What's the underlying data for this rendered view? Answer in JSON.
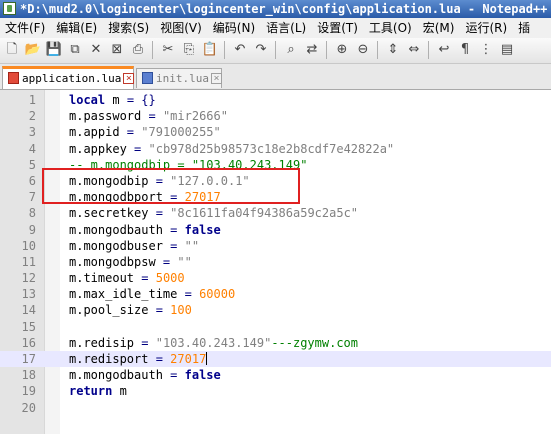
{
  "window": {
    "title": "*D:\\mud2.0\\logincenter\\logincenter_win\\config\\application.lua - Notepad++ [A"
  },
  "menu": [
    "文件(F)",
    "编辑(E)",
    "搜索(S)",
    "视图(V)",
    "编码(N)",
    "语言(L)",
    "设置(T)",
    "工具(O)",
    "宏(M)",
    "运行(R)",
    "插"
  ],
  "toolbar_icons": [
    "new-file-icon",
    "open-file-icon",
    "save-icon",
    "save-all-icon",
    "close-icon",
    "close-all-icon",
    "print-icon",
    "cut-icon",
    "copy-icon",
    "paste-icon",
    "undo-icon",
    "redo-icon",
    "find-icon",
    "replace-icon",
    "zoom-in-icon",
    "zoom-out-icon",
    "sync-vertical-icon",
    "sync-horizontal-icon",
    "word-wrap-icon",
    "show-all-chars-icon",
    "indent-guide-icon",
    "document-map-icon"
  ],
  "tabs": [
    {
      "label": "application.lua",
      "active": true,
      "modified": true
    },
    {
      "label": "init.lua",
      "active": false,
      "modified": false
    }
  ],
  "editor": {
    "current_line": 17,
    "highlighted_lines": [
      6,
      7
    ],
    "lines": [
      {
        "n": "1",
        "tokens": [
          [
            "kw",
            "local"
          ],
          [
            "t",
            " m "
          ],
          [
            "op",
            "="
          ],
          [
            "t",
            " "
          ],
          [
            "op",
            "{}"
          ]
        ]
      },
      {
        "n": "2",
        "tokens": [
          [
            "t",
            "m.password "
          ],
          [
            "op",
            "="
          ],
          [
            "t",
            " "
          ],
          [
            "str",
            "\"mir2666\""
          ]
        ]
      },
      {
        "n": "3",
        "tokens": [
          [
            "t",
            "m.appid "
          ],
          [
            "op",
            "="
          ],
          [
            "t",
            " "
          ],
          [
            "str",
            "\"791000255\""
          ]
        ]
      },
      {
        "n": "4",
        "tokens": [
          [
            "t",
            "m.appkey "
          ],
          [
            "op",
            "="
          ],
          [
            "t",
            " "
          ],
          [
            "str",
            "\"cb978d25b98573c18e2b8cdf7e42822a\""
          ]
        ]
      },
      {
        "n": "5",
        "tokens": [
          [
            "cmt",
            "-- m.mongodbip = \"103.40.243.149\""
          ]
        ]
      },
      {
        "n": "6",
        "tokens": [
          [
            "t",
            "m.mongodbip "
          ],
          [
            "op",
            "="
          ],
          [
            "t",
            " "
          ],
          [
            "str",
            "\"127.0.0.1\""
          ]
        ]
      },
      {
        "n": "7",
        "tokens": [
          [
            "t",
            "m.mongodbport "
          ],
          [
            "op",
            "="
          ],
          [
            "t",
            " "
          ],
          [
            "num",
            "27017"
          ]
        ]
      },
      {
        "n": "8",
        "tokens": [
          [
            "t",
            "m.secretkey "
          ],
          [
            "op",
            "="
          ],
          [
            "t",
            " "
          ],
          [
            "str",
            "\"8c1611fa04f94386a59c2a5c\""
          ]
        ]
      },
      {
        "n": "9",
        "tokens": [
          [
            "t",
            "m.mongodbauth "
          ],
          [
            "op",
            "="
          ],
          [
            "t",
            " "
          ],
          [
            "kw",
            "false"
          ]
        ]
      },
      {
        "n": "10",
        "tokens": [
          [
            "t",
            "m.mongodbuser "
          ],
          [
            "op",
            "="
          ],
          [
            "t",
            " "
          ],
          [
            "str",
            "\"\""
          ]
        ]
      },
      {
        "n": "11",
        "tokens": [
          [
            "t",
            "m.mongodbpsw "
          ],
          [
            "op",
            "="
          ],
          [
            "t",
            " "
          ],
          [
            "str",
            "\"\""
          ]
        ]
      },
      {
        "n": "12",
        "tokens": [
          [
            "t",
            "m.timeout "
          ],
          [
            "op",
            "="
          ],
          [
            "t",
            " "
          ],
          [
            "num",
            "5000"
          ]
        ]
      },
      {
        "n": "13",
        "tokens": [
          [
            "t",
            "m.max_idle_time "
          ],
          [
            "op",
            "="
          ],
          [
            "t",
            " "
          ],
          [
            "num",
            "60000"
          ]
        ]
      },
      {
        "n": "14",
        "tokens": [
          [
            "t",
            "m.pool_size "
          ],
          [
            "op",
            "="
          ],
          [
            "t",
            " "
          ],
          [
            "num",
            "100"
          ]
        ]
      },
      {
        "n": "15",
        "tokens": []
      },
      {
        "n": "16",
        "tokens": [
          [
            "t",
            "m.redisip "
          ],
          [
            "op",
            "="
          ],
          [
            "t",
            " "
          ],
          [
            "str",
            "\"103.40.243.149\""
          ],
          [
            "cmt",
            "---zgymw.com"
          ]
        ]
      },
      {
        "n": "17",
        "tokens": [
          [
            "t",
            "m.redisport "
          ],
          [
            "op",
            "="
          ],
          [
            "t",
            " "
          ],
          [
            "num",
            "27017"
          ]
        ]
      },
      {
        "n": "18",
        "tokens": [
          [
            "t",
            "m.mongodbauth "
          ],
          [
            "op",
            "="
          ],
          [
            "t",
            " "
          ],
          [
            "kw",
            "false"
          ]
        ]
      },
      {
        "n": "19",
        "tokens": [
          [
            "kw",
            "return"
          ],
          [
            "t",
            " m"
          ]
        ]
      },
      {
        "n": "20",
        "tokens": []
      }
    ]
  }
}
